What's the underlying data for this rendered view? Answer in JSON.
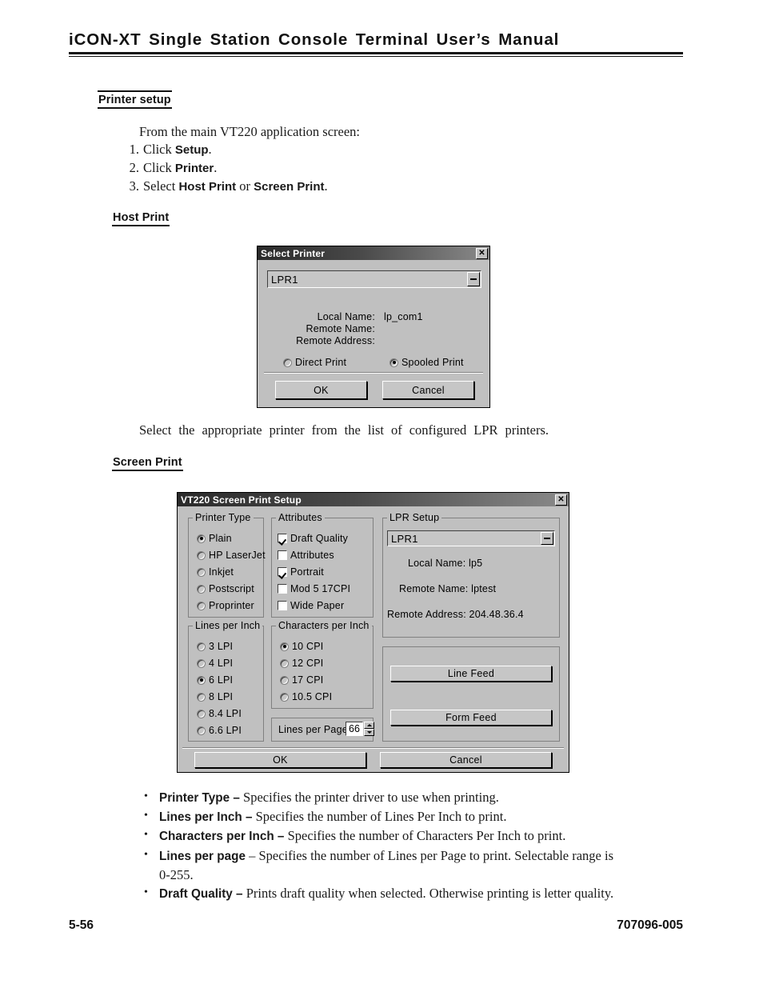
{
  "header": {
    "title": "iCON-XT  Single  Station  Console  Terminal  User’s  Manual"
  },
  "sections": {
    "printer_setup": {
      "heading": "Printer setup",
      "intro": "From  the  main  VT220  application  screen:",
      "steps": [
        {
          "num": "1.",
          "pre": "Click ",
          "bold": "Setup",
          "post": "."
        },
        {
          "num": "2.",
          "pre": "Click ",
          "bold": "Printer",
          "post": "."
        },
        {
          "num": "3.",
          "pre": "Select ",
          "bold": "Host Print",
          "mid": " or ",
          "bold2": "Screen Print",
          "post": "."
        }
      ]
    },
    "host_print": {
      "heading": "Host Print",
      "caption": "Select  the  appropriate  printer  from  the  list  of  configured  LPR  printers."
    },
    "screen_print": {
      "heading": "Screen Print"
    }
  },
  "select_printer_dialog": {
    "title": "Select Printer",
    "close_label": "✕",
    "printer_combo_value": "LPR1",
    "fields": [
      {
        "label": "Local Name:",
        "value": "lp_com1"
      },
      {
        "label": "Remote Name:",
        "value": ""
      },
      {
        "label": "Remote Address:",
        "value": ""
      }
    ],
    "print_mode": {
      "direct": {
        "label": "Direct Print",
        "selected": false
      },
      "spooled": {
        "label": "Spooled Print",
        "selected": true
      }
    },
    "ok_label": "OK",
    "cancel_label": "Cancel"
  },
  "screen_print_dialog": {
    "title": "VT220 Screen Print Setup",
    "close_label": "✕",
    "printer_type": {
      "title": "Printer Type",
      "options": [
        {
          "label": "Plain",
          "selected": true
        },
        {
          "label": "HP LaserJet",
          "selected": false
        },
        {
          "label": "Inkjet",
          "selected": false
        },
        {
          "label": "Postscript",
          "selected": false
        },
        {
          "label": "Proprinter",
          "selected": false
        }
      ]
    },
    "attributes": {
      "title": "Attributes",
      "options": [
        {
          "label": "Draft Quality",
          "checked": true
        },
        {
          "label": "Attributes",
          "checked": false
        },
        {
          "label": "Portrait",
          "checked": true
        },
        {
          "label": "Mod 5 17CPI",
          "checked": false
        },
        {
          "label": "Wide Paper",
          "checked": false
        }
      ]
    },
    "lines_per_inch": {
      "title": "Lines per Inch",
      "options": [
        {
          "label": "3 LPI",
          "selected": false
        },
        {
          "label": "4 LPI",
          "selected": false
        },
        {
          "label": "6 LPI",
          "selected": true
        },
        {
          "label": "8 LPI",
          "selected": false
        },
        {
          "label": "8.4 LPI",
          "selected": false
        },
        {
          "label": "6.6 LPI",
          "selected": false
        }
      ]
    },
    "characters_per_inch": {
      "title": "Characters per Inch",
      "options": [
        {
          "label": "10 CPI",
          "selected": true
        },
        {
          "label": "12 CPI",
          "selected": false
        },
        {
          "label": "17 CPI",
          "selected": false
        },
        {
          "label": "10.5 CPI",
          "selected": false
        }
      ]
    },
    "lines_per_page": {
      "label": "Lines per Page",
      "value": "66"
    },
    "lpr_setup": {
      "title": "LPR Setup",
      "combo_value": "LPR1",
      "local_name": "Local Name: lp5",
      "remote_name": "Remote Name: lptest",
      "remote_address": "Remote Address: 204.48.36.4"
    },
    "feed_buttons": {
      "line_feed": "Line Feed",
      "form_feed": "Form Feed"
    },
    "ok_label": "OK",
    "cancel_label": "Cancel"
  },
  "definitions": [
    {
      "term": "Printer Type –",
      "desc": " Specifies the printer driver to use when printing."
    },
    {
      "term": "Lines per Inch –",
      "desc": " Specifies the number of Lines Per Inch to print."
    },
    {
      "term": "Characters per Inch –",
      "desc": " Specifies the number of Characters Per Inch to print."
    },
    {
      "term": "Lines per page",
      "desc": " – Specifies the number of Lines per Page to print. Selectable range is 0-255."
    },
    {
      "term": "Draft Quality –",
      "desc": " Prints draft quality when selected. Otherwise printing is letter quality."
    }
  ],
  "footer": {
    "page_number": "5-56",
    "doc_number": "707096-005"
  }
}
